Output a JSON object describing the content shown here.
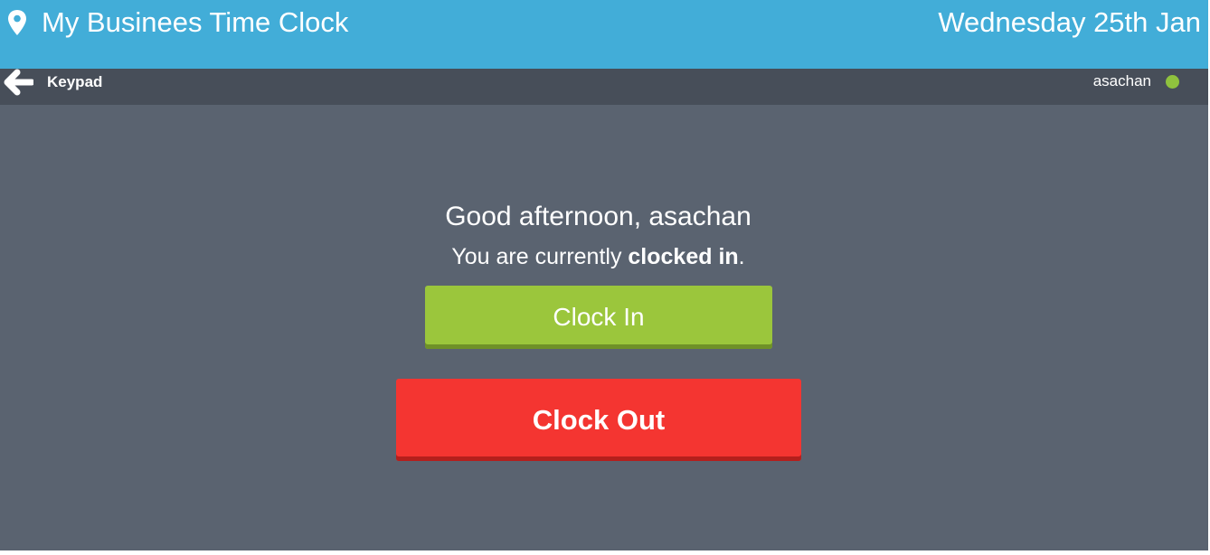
{
  "header": {
    "location_icon": "map-pin-icon",
    "app_title": "My Businees Time Clock",
    "date": "Wednesday 25th Jan"
  },
  "subbar": {
    "back_icon": "arrow-left-icon",
    "back_label": "Keypad",
    "username": "asachan",
    "status_indicator": "online-dot",
    "status_color": "#8fc23e"
  },
  "main": {
    "greeting": "Good afternoon, asachan",
    "status_prefix": "You are currently ",
    "status_emphasis": "clocked in",
    "status_suffix": ".",
    "clock_in_label": "Clock In",
    "clock_out_label": "Clock Out"
  },
  "colors": {
    "header_bg": "#42add8",
    "subbar_bg": "#474e59",
    "body_bg": "#5a6370",
    "clock_in": "#9bc63c",
    "clock_out": "#f43531"
  }
}
